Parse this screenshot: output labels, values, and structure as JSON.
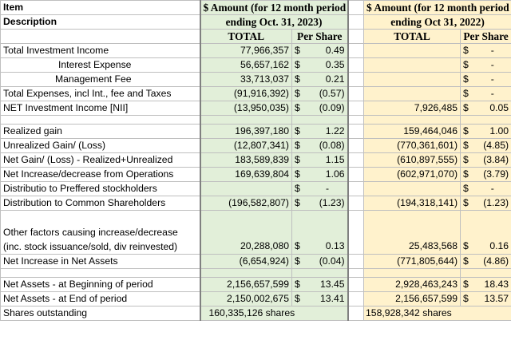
{
  "header": {
    "item_line1": "Item",
    "item_line2": "Description",
    "col2023_line1": "$ Amount (for 12 month period",
    "col2023_line2": "ending Oct. 31, 2023)",
    "col2022_line1": "$ Amount (for 12 month period",
    "col2022_line2": "ending Oct 31, 2022)",
    "total_label": "TOTAL",
    "per_share_label": "Per Share"
  },
  "currency_symbol": "$",
  "colors": {
    "green_fill": "#e2efd9",
    "yellow_fill": "#fff2cc",
    "grid": "#bfbfbf"
  },
  "rows": {
    "total_investment_income": {
      "label": "Total Investment Income",
      "t23": "77,966,357",
      "c23": "$",
      "p23": "0.49",
      "t22": "",
      "c22": "$",
      "p22": "-"
    },
    "interest_expense": {
      "label": "Interest Expense",
      "t23": "56,657,162",
      "c23": "$",
      "p23": "0.35",
      "t22": "",
      "c22": "$",
      "p22": "-"
    },
    "management_fee": {
      "label": "Management Fee",
      "t23": "33,713,037",
      "c23": "$",
      "p23": "0.21",
      "t22": "",
      "c22": "$",
      "p22": "-"
    },
    "total_expenses": {
      "label": "Total Expenses, incl Int., fee and Taxes",
      "t23": "(91,916,392)",
      "c23": "$",
      "p23": "(0.57)",
      "t22": "",
      "c22": "$",
      "p22": "-"
    },
    "nii": {
      "label": "NET Investment Income [NII]",
      "t23": "(13,950,035)",
      "c23": "$",
      "p23": "(0.09)",
      "t22": "7,926,485",
      "c22": "$",
      "p22": "0.05"
    },
    "realized_gain": {
      "label": "Realized gain",
      "t23": "196,397,180",
      "c23": "$",
      "p23": "1.22",
      "t22": "159,464,046",
      "c22": "$",
      "p22": "1.00"
    },
    "unrealized": {
      "label": "Unrealized Gain/ (Loss)",
      "t23": "(12,807,341)",
      "c23": "$",
      "p23": "(0.08)",
      "t22": "(770,361,601)",
      "c22": "$",
      "p22": "(4.85)"
    },
    "net_gain": {
      "label": "Net Gain/ (Loss) - Realized+Unrealized",
      "t23": "183,589,839",
      "c23": "$",
      "p23": "1.15",
      "t22": "(610,897,555)",
      "c22": "$",
      "p22": "(3.84)"
    },
    "net_incdec_ops": {
      "label": "Net Increase/decrease from Operations",
      "t23": "169,639,804",
      "c23": "$",
      "p23": "1.06",
      "t22": "(602,971,070)",
      "c22": "$",
      "p22": "(3.79)"
    },
    "dist_preferred": {
      "label": "Distributio to Preffered stockholders",
      "t23": "",
      "c23": "$",
      "p23": "-",
      "t22": "",
      "c22": "$",
      "p22": "-"
    },
    "dist_common": {
      "label": "Distribution to Common Shareholders",
      "t23": "(196,582,807)",
      "c23": "$",
      "p23": "(1.23)",
      "t22": "(194,318,141)",
      "c22": "$",
      "p22": "(1.23)"
    },
    "other_factors": {
      "label_line1": "Other factors causing increase/decrease",
      "label_line2": "(inc. stock issuance/sold, div reinvested)",
      "t23": "20,288,080",
      "c23": "$",
      "p23": "0.13",
      "t22": "25,483,568",
      "c22": "$",
      "p22": "0.16"
    },
    "net_increase_assets": {
      "label": "Net Increase in Net Assets",
      "t23": "(6,654,924)",
      "c23": "$",
      "p23": "(0.04)",
      "t22": "(771,805,644)",
      "c22": "$",
      "p22": "(4.86)"
    },
    "na_begin": {
      "label": "Net Assets - at Beginning of period",
      "t23": "2,156,657,599",
      "c23": "$",
      "p23": "13.45",
      "t22": "2,928,463,243",
      "c22": "$",
      "p22": "18.43"
    },
    "na_end": {
      "label": "Net Assets - at End of period",
      "t23": "2,150,002,675",
      "c23": "$",
      "p23": "13.41",
      "t22": "2,156,657,599",
      "c22": "$",
      "p22": "13.57"
    },
    "shares_outstanding": {
      "label": "Shares outstanding",
      "v23": "160,335,126 shares",
      "v22": "158,928,342 shares"
    }
  }
}
